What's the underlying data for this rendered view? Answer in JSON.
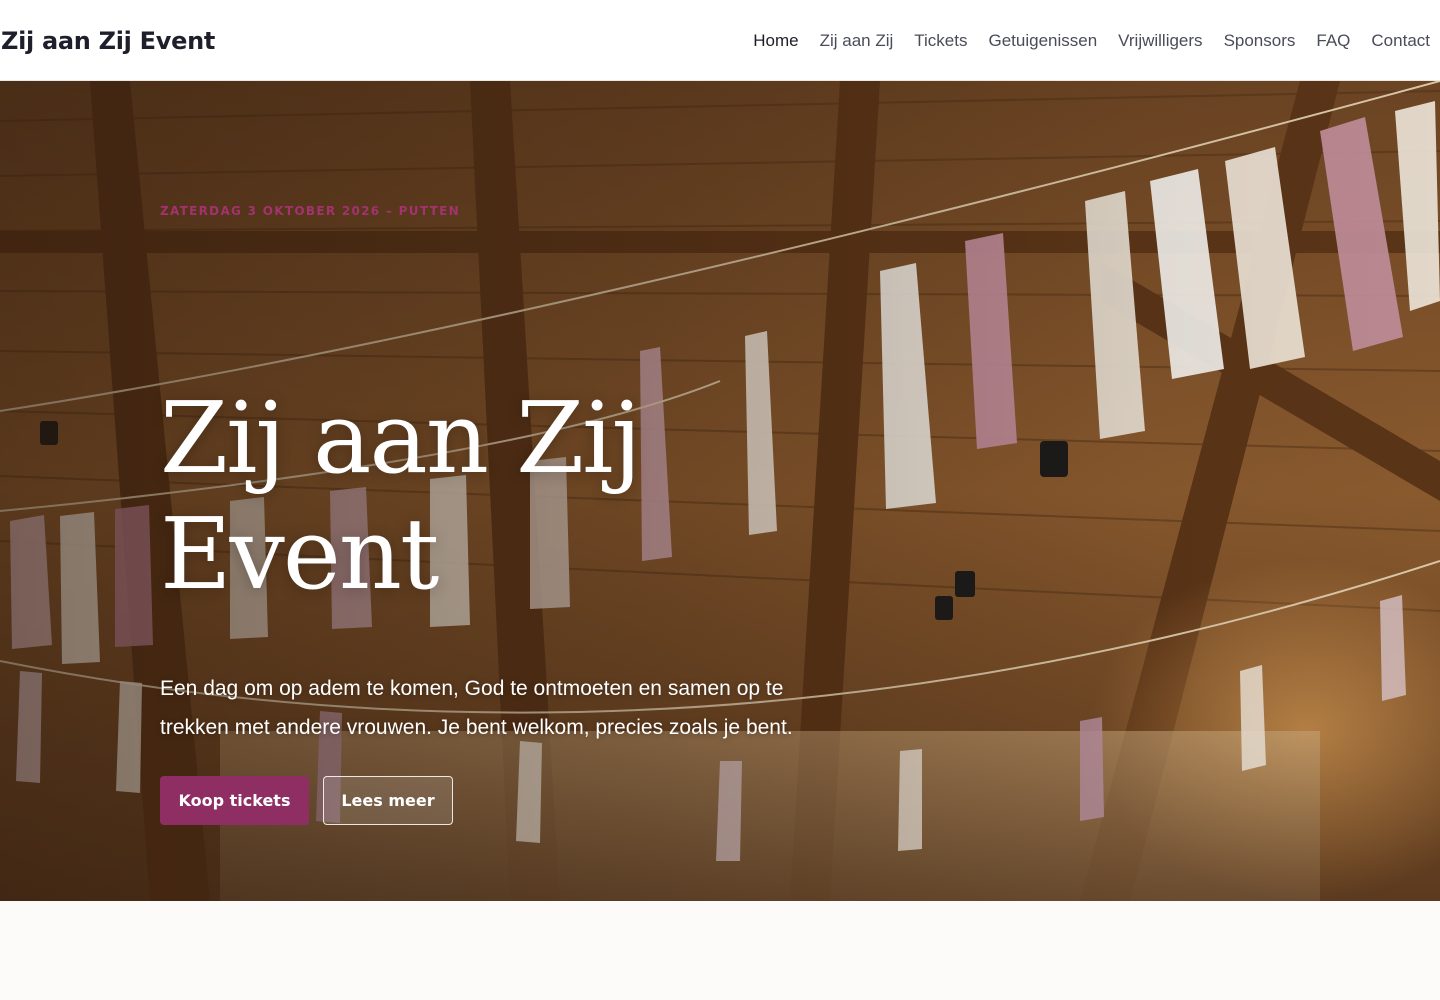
{
  "header": {
    "brand": "Zij aan Zij Event",
    "nav": [
      {
        "label": "Home",
        "active": true
      },
      {
        "label": "Zij aan Zij"
      },
      {
        "label": "Tickets"
      },
      {
        "label": "Getuigenissen"
      },
      {
        "label": "Vrijwilligers"
      },
      {
        "label": "Sponsors"
      },
      {
        "label": "FAQ"
      },
      {
        "label": "Contact"
      }
    ]
  },
  "hero": {
    "eyebrow": "Zaterdag 3 oktober 2026 – Putten",
    "title": "Zij aan Zij Event",
    "subtitle": "Een dag om op adem te komen, God te ontmoeten en samen op te trekken met andere vrouwen. Je bent welkom, precies zoals je bent.",
    "primary_button": "Koop tickets",
    "secondary_button": "Lees meer"
  },
  "colors": {
    "accent": "#8e2e63",
    "eyebrow": "#a3326f",
    "header_bg": "#ffffff",
    "page_bg": "#fdfbf9"
  }
}
